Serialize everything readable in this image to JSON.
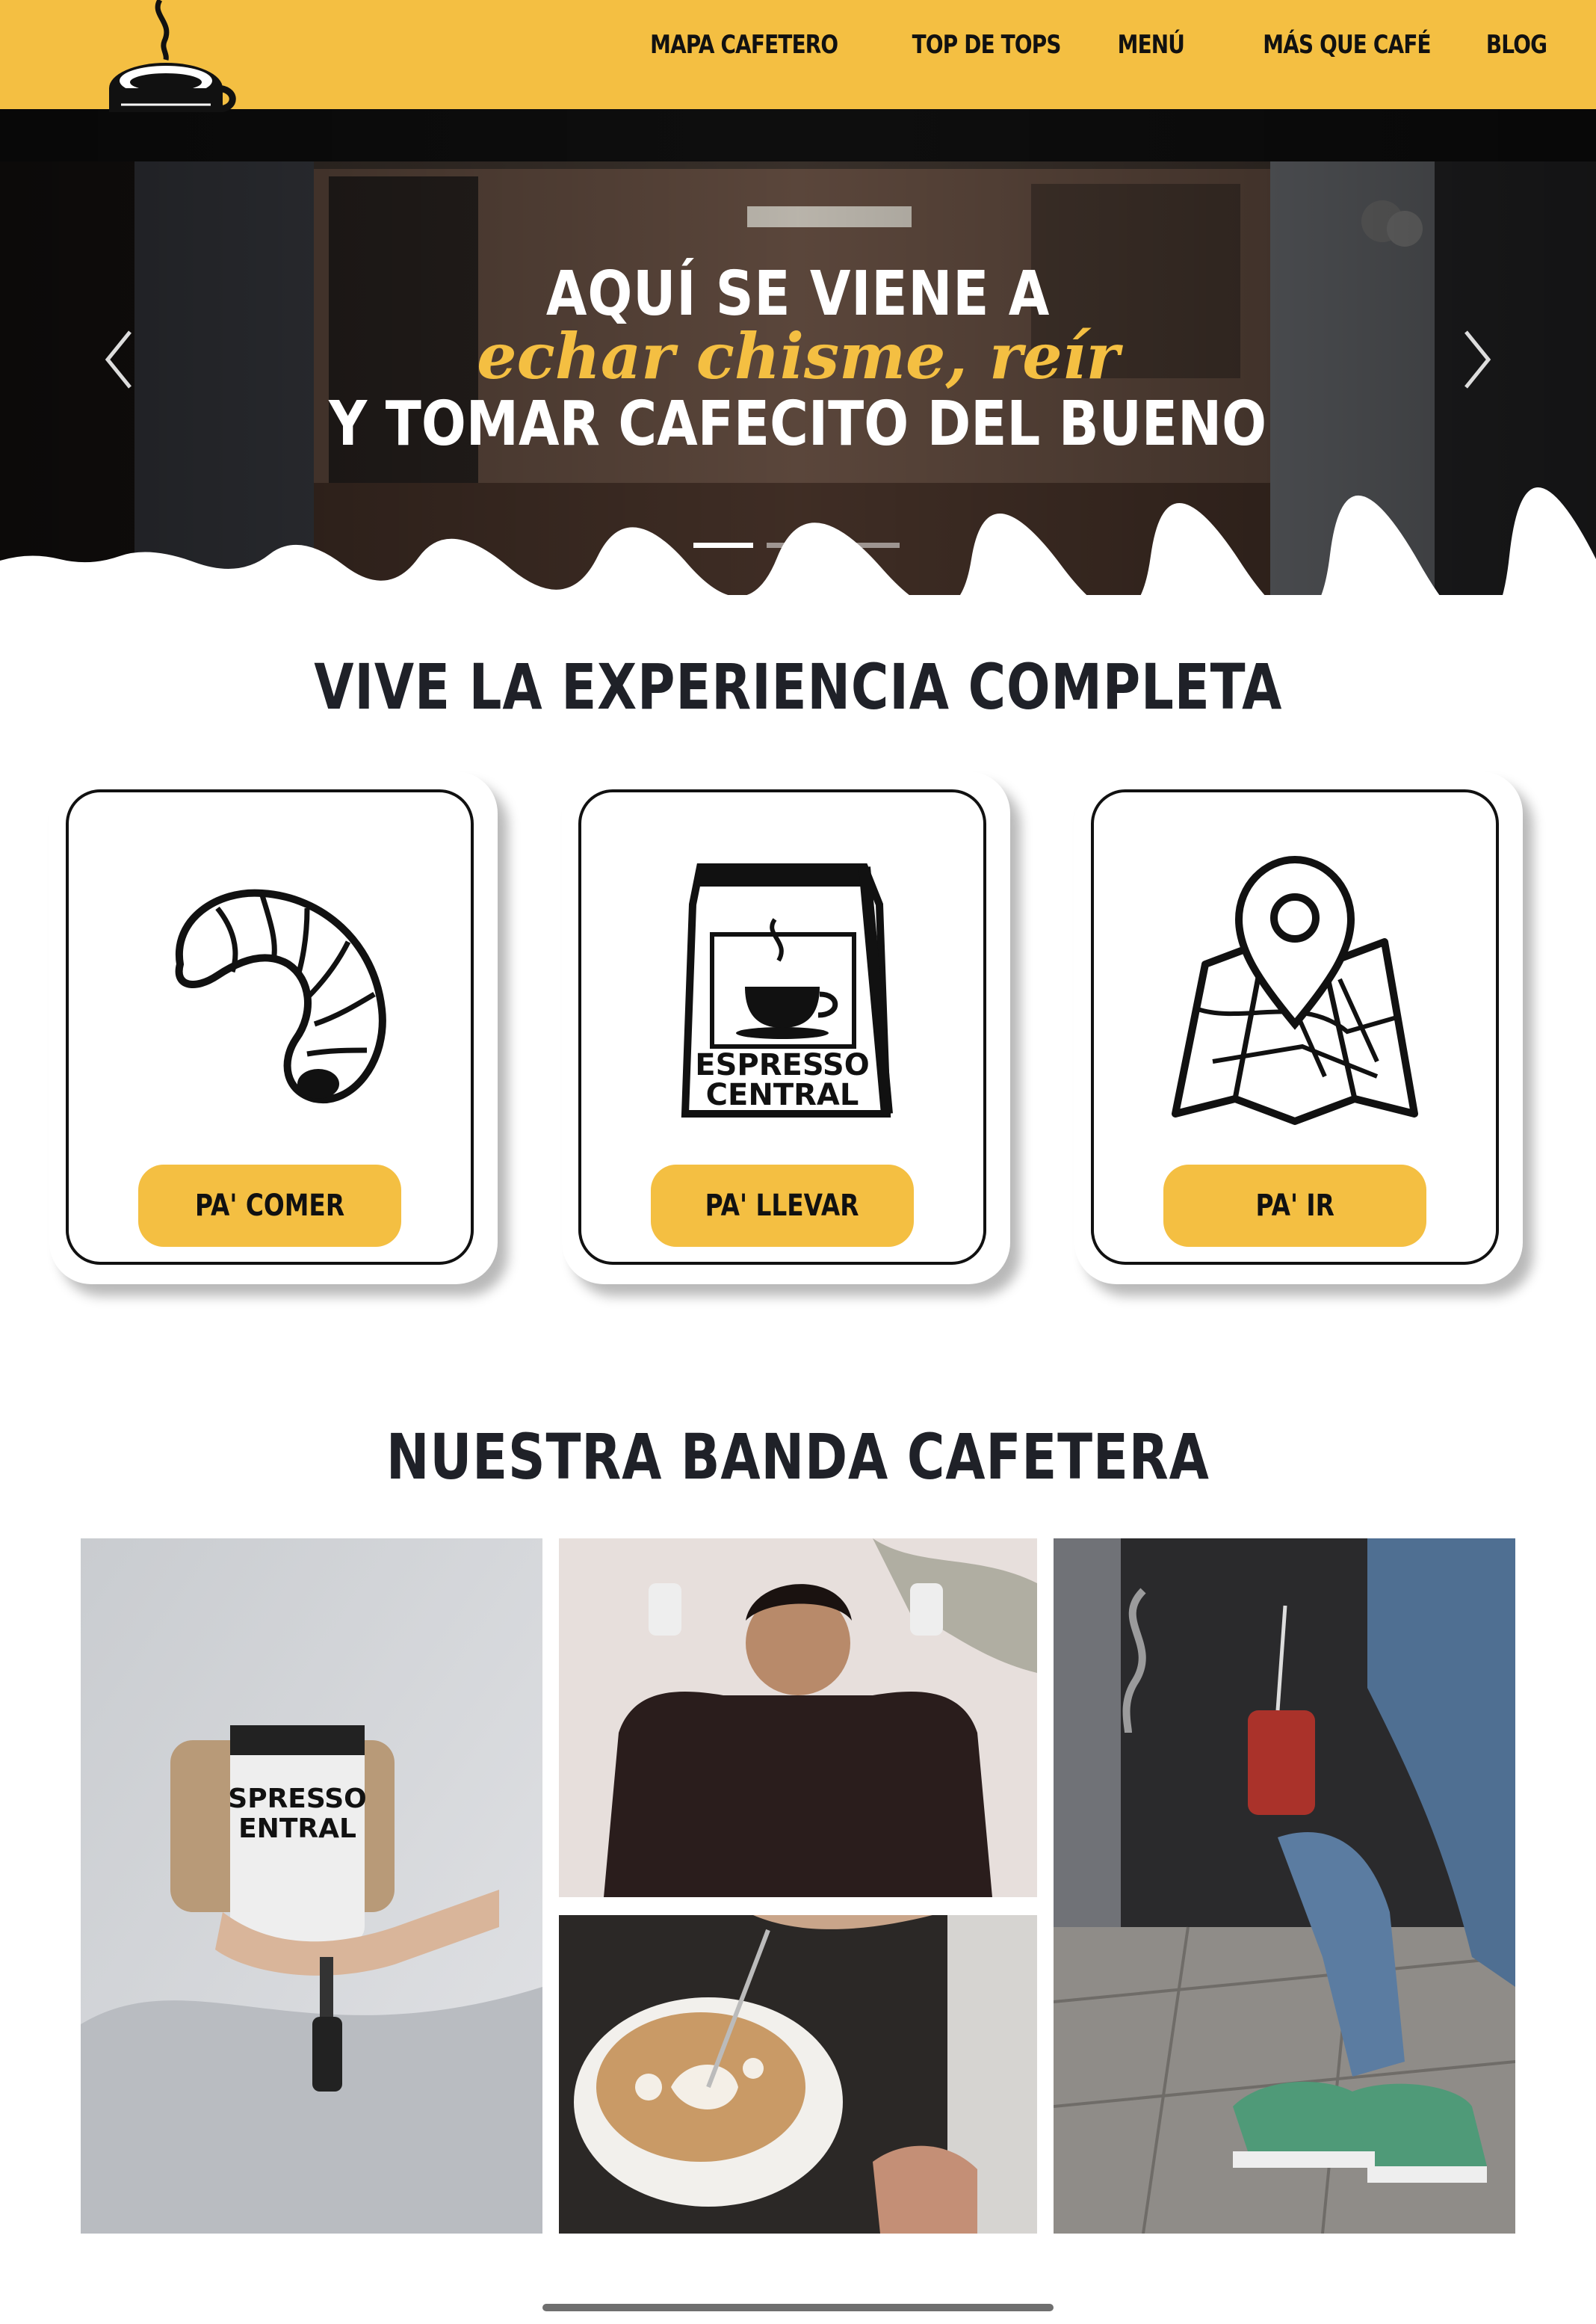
{
  "header": {
    "nav": [
      "MAPA CAFETERO",
      "TOP DE TOPS",
      "MENÚ",
      "MÁS QUE CAFÉ",
      "BLOG"
    ]
  },
  "hero": {
    "line1": "AQUÍ SE VIENE A",
    "line2": "echar chisme, reír",
    "line3": "Y TOMAR CAFECITO DEL BUENO",
    "slides": 3,
    "active_slide": 1
  },
  "experience": {
    "title": "VIVE LA EXPERIENCIA COMPLETA",
    "cards": [
      {
        "icon": "croissant-icon",
        "button": "PA' COMER"
      },
      {
        "icon": "coffee-bag-icon",
        "button": "PA' LLEVAR",
        "bag_text_1": "ESPRESSO",
        "bag_text_2": "CENTRAL"
      },
      {
        "icon": "map-pin-icon",
        "button": "PA' IR"
      }
    ]
  },
  "community": {
    "title": "NUESTRA BANDA CAFETERA",
    "photos": [
      "cup-with-wallet-photo",
      "smiling-man-photo",
      "latte-art-photo",
      "iced-drink-sneakers-photo"
    ]
  },
  "colors": {
    "brand_yellow": "#f4bf42",
    "dark": "#1f2128"
  }
}
